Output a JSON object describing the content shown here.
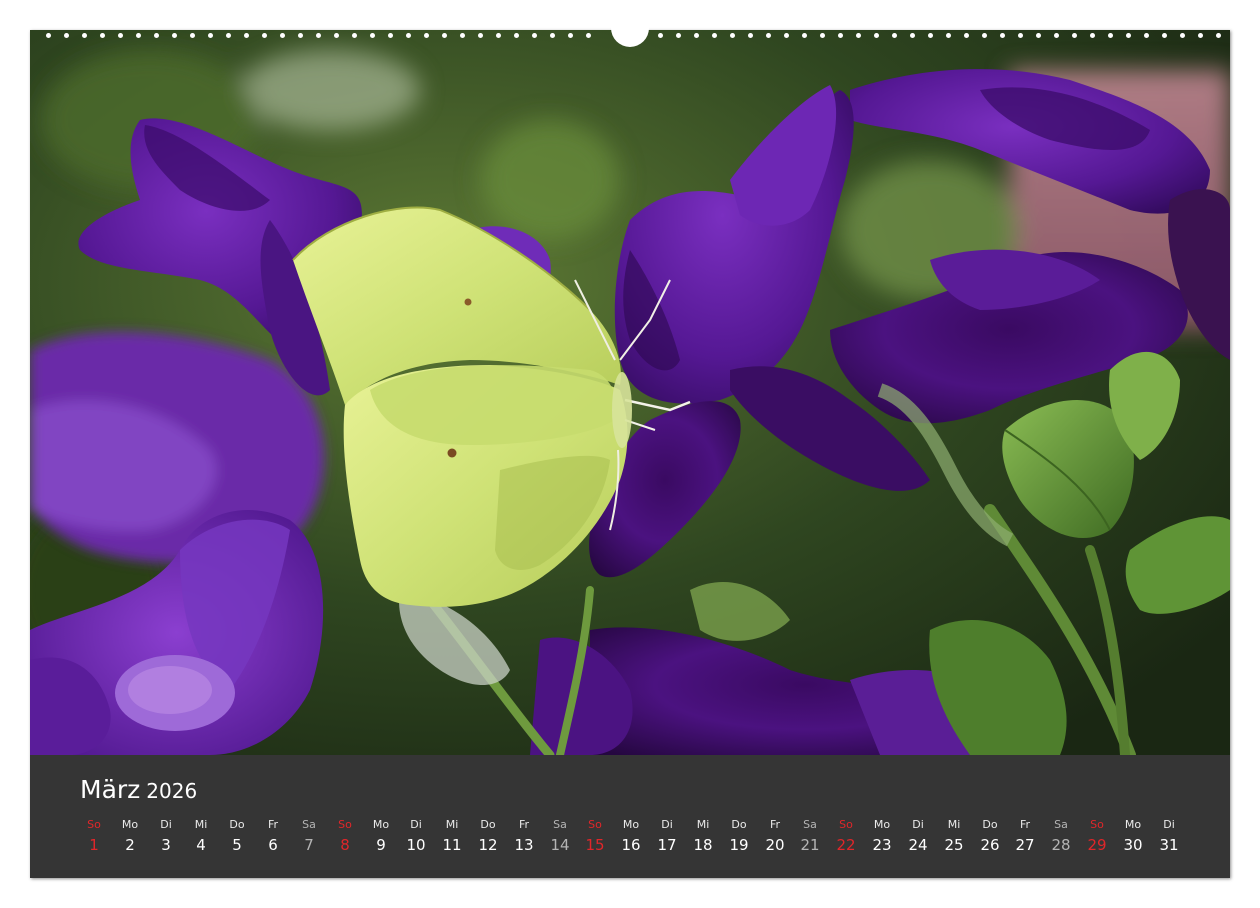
{
  "calendar": {
    "month": "März",
    "year": "2026",
    "days": [
      {
        "weekday": "So",
        "day": "1",
        "type": "sun"
      },
      {
        "weekday": "Mo",
        "day": "2",
        "type": "wd"
      },
      {
        "weekday": "Di",
        "day": "3",
        "type": "wd"
      },
      {
        "weekday": "Mi",
        "day": "4",
        "type": "wd"
      },
      {
        "weekday": "Do",
        "day": "5",
        "type": "wd"
      },
      {
        "weekday": "Fr",
        "day": "6",
        "type": "wd"
      },
      {
        "weekday": "Sa",
        "day": "7",
        "type": "sat"
      },
      {
        "weekday": "So",
        "day": "8",
        "type": "sun"
      },
      {
        "weekday": "Mo",
        "day": "9",
        "type": "wd"
      },
      {
        "weekday": "Di",
        "day": "10",
        "type": "wd"
      },
      {
        "weekday": "Mi",
        "day": "11",
        "type": "wd"
      },
      {
        "weekday": "Do",
        "day": "12",
        "type": "wd"
      },
      {
        "weekday": "Fr",
        "day": "13",
        "type": "wd"
      },
      {
        "weekday": "Sa",
        "day": "14",
        "type": "sat"
      },
      {
        "weekday": "So",
        "day": "15",
        "type": "sun"
      },
      {
        "weekday": "Mo",
        "day": "16",
        "type": "wd"
      },
      {
        "weekday": "Di",
        "day": "17",
        "type": "wd"
      },
      {
        "weekday": "Mi",
        "day": "18",
        "type": "wd"
      },
      {
        "weekday": "Do",
        "day": "19",
        "type": "wd"
      },
      {
        "weekday": "Fr",
        "day": "20",
        "type": "wd"
      },
      {
        "weekday": "Sa",
        "day": "21",
        "type": "sat"
      },
      {
        "weekday": "So",
        "day": "22",
        "type": "sun"
      },
      {
        "weekday": "Mo",
        "day": "23",
        "type": "wd"
      },
      {
        "weekday": "Di",
        "day": "24",
        "type": "wd"
      },
      {
        "weekday": "Mi",
        "day": "25",
        "type": "wd"
      },
      {
        "weekday": "Do",
        "day": "26",
        "type": "wd"
      },
      {
        "weekday": "Fr",
        "day": "27",
        "type": "wd"
      },
      {
        "weekday": "Sa",
        "day": "28",
        "type": "sat"
      },
      {
        "weekday": "So",
        "day": "29",
        "type": "sun"
      },
      {
        "weekday": "Mo",
        "day": "30",
        "type": "wd"
      },
      {
        "weekday": "Di",
        "day": "31",
        "type": "wd"
      }
    ]
  },
  "photo": {
    "subject": "butterfly-on-petunias",
    "colors": {
      "bar": "#353535",
      "sunday": "#e0262a",
      "saturday": "#b4b4b4",
      "text": "#ffffff",
      "petal": "#5a1890",
      "wing": "#d6ea7c"
    }
  }
}
